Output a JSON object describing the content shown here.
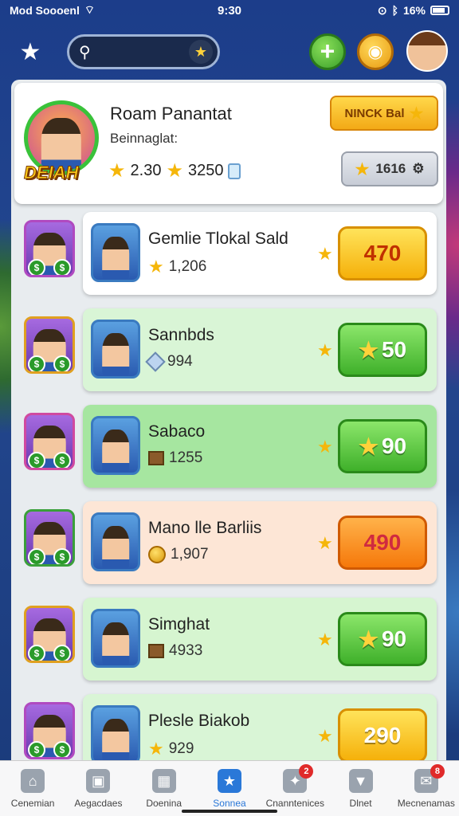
{
  "status_bar": {
    "carrier": "Mod Soooenl",
    "time": "9:30",
    "battery": "16%"
  },
  "topbar": {
    "search_placeholder": ""
  },
  "profile": {
    "name": "Roam Panantat",
    "subtitle": "Beinnaglat:",
    "badge_text": "DEIAH",
    "stat_1": "2.30",
    "stat_2": "3250",
    "rank_button": "NINCK Bal",
    "score_button": "1616"
  },
  "rows": [
    {
      "name": "Gemlie Tlokal Sald",
      "stat": "1,206",
      "price": "470",
      "card_bg": "#ffffff",
      "price_style": "p-yellow",
      "stat_icon": "star",
      "mini_border": "#b04ac0"
    },
    {
      "name": "Sannbds",
      "stat": "994",
      "price": "50",
      "card_bg": "#d9f5d6",
      "price_style": "p-green",
      "stat_icon": "gem",
      "mini_border": "#e0a020"
    },
    {
      "name": "Sabaco",
      "stat": "1255",
      "price": "90",
      "card_bg": "#a6e6a0",
      "price_style": "p-green",
      "stat_icon": "crate",
      "mini_border": "#d04aa0"
    },
    {
      "name": "Mano lle Barliis",
      "stat": "1,907",
      "price": "490",
      "card_bg": "#fde6d6",
      "price_style": "p-orange",
      "stat_icon": "coin",
      "mini_border": "#3aa03a"
    },
    {
      "name": "Simghat",
      "stat": "4933",
      "price": "90",
      "card_bg": "#d6f5d0",
      "price_style": "p-green",
      "stat_icon": "crate",
      "mini_border": "#e0a020"
    },
    {
      "name": "Plesle Biakob",
      "stat": "929",
      "price": "290",
      "card_bg": "#d9f5d6",
      "price_style": "p-yellow2",
      "stat_icon": "star",
      "mini_border": "#b04ac0"
    }
  ],
  "nav": [
    {
      "label": "Cenemian",
      "icon": "home-icon",
      "glyph": "⌂",
      "badge": ""
    },
    {
      "label": "Aegacdaes",
      "icon": "achievements-icon",
      "glyph": "▣",
      "badge": ""
    },
    {
      "label": "Doenina",
      "icon": "grid-icon",
      "glyph": "▦",
      "badge": ""
    },
    {
      "label": "Sonnea",
      "icon": "star-icon",
      "glyph": "★",
      "badge": "",
      "active": true
    },
    {
      "label": "Cnanntenices",
      "icon": "challenges-icon",
      "glyph": "✦",
      "badge": "2"
    },
    {
      "label": "Dlnet",
      "icon": "shield-icon",
      "glyph": "▼",
      "badge": ""
    },
    {
      "label": "Mecnenamas",
      "icon": "messages-icon",
      "glyph": "✉",
      "badge": "8"
    }
  ]
}
